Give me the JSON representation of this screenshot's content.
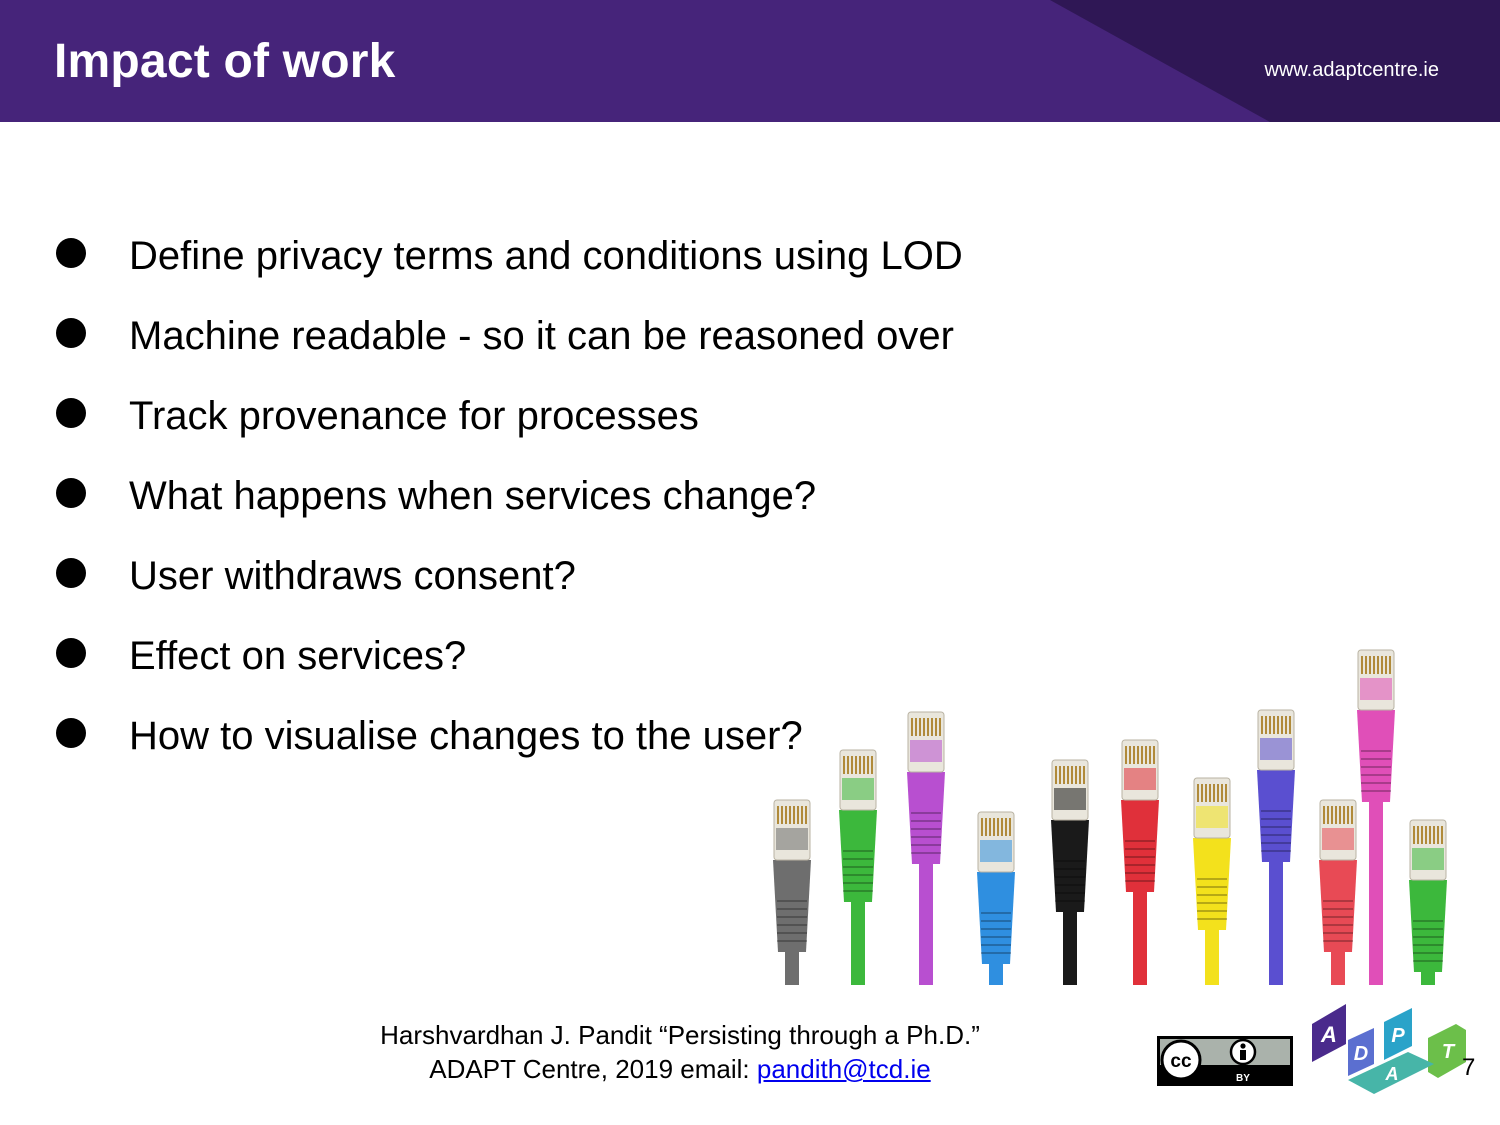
{
  "header": {
    "title": "Impact of work",
    "website": "www.adaptcentre.ie"
  },
  "bullets": [
    "Define privacy terms and conditions using LOD",
    "Machine readable - so it can be reasoned over",
    "Track provenance for processes",
    "What happens when services change?",
    "User withdraws consent?",
    "Effect on services?",
    "How to visualise changes to the user?"
  ],
  "footer": {
    "line1": "Harshvardhan J. Pandit “Persisting through a Ph.D.”",
    "line2_prefix": "ADAPT Centre, 2019  email: ",
    "email": "pandith@tcd.ie"
  },
  "license": {
    "cc": "cc",
    "by": "BY"
  },
  "logo": {
    "letters": [
      "A",
      "D",
      "P",
      "T",
      "A"
    ]
  },
  "page_number": "7",
  "colors": {
    "header_bg": "#46247a",
    "cables": [
      "#6e6e6e",
      "#3cb83c",
      "#b84fd0",
      "#2f8fe0",
      "#1a1a1a",
      "#e0303a",
      "#f3e11c",
      "#5a4fd0",
      "#e84a55",
      "#e04fb8",
      "#3cb83c"
    ]
  }
}
